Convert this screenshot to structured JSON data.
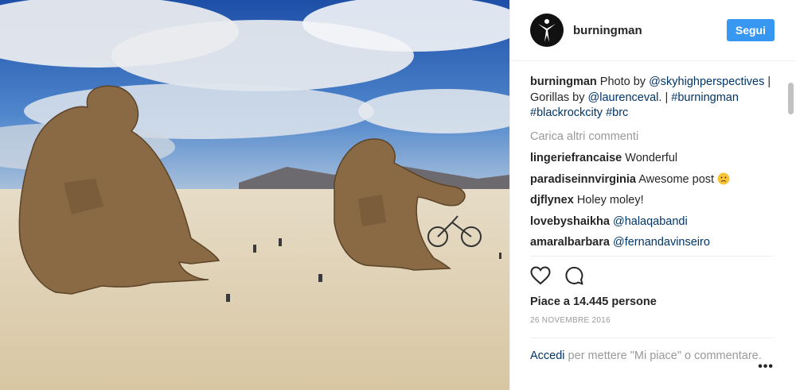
{
  "post": {
    "username": "burningman",
    "follow_label": "Segui"
  },
  "caption": {
    "username": "burningman",
    "text_1": " Photo by ",
    "mention_1": "@skyhighperspectives",
    "text_2": " | Gorillas by ",
    "mention_2": "@laurenceval.",
    "text_3": " | ",
    "tag_1": "#burningman",
    "tag_2": "#blackrockcity",
    "tag_3": "#brc"
  },
  "load_more": "Carica altri commenti",
  "comments": [
    {
      "user": "lingeriefrancaise",
      "text": "Wonderful",
      "mention": ""
    },
    {
      "user": "paradiseinnvirginia",
      "text": "Awesome post ",
      "mention": ""
    },
    {
      "user": "djflynex",
      "text": "Holey moley!",
      "mention": ""
    },
    {
      "user": "lovebyshaikha",
      "text": "",
      "mention": "@halaqabandi"
    },
    {
      "user": "amaralbarbara",
      "text": "",
      "mention": "@fernandavinseiro"
    }
  ],
  "likes": "Piace a 14.445 persone",
  "date": "26 NOVEMBRE 2016",
  "login": {
    "link": "Accedi",
    "text": " per mettere \"Mi piace\" o commentare."
  },
  "more_options": "•••",
  "icons": {
    "like": "heart-icon",
    "comment": "comment-icon",
    "emoji": "sad-smile-emoji"
  }
}
